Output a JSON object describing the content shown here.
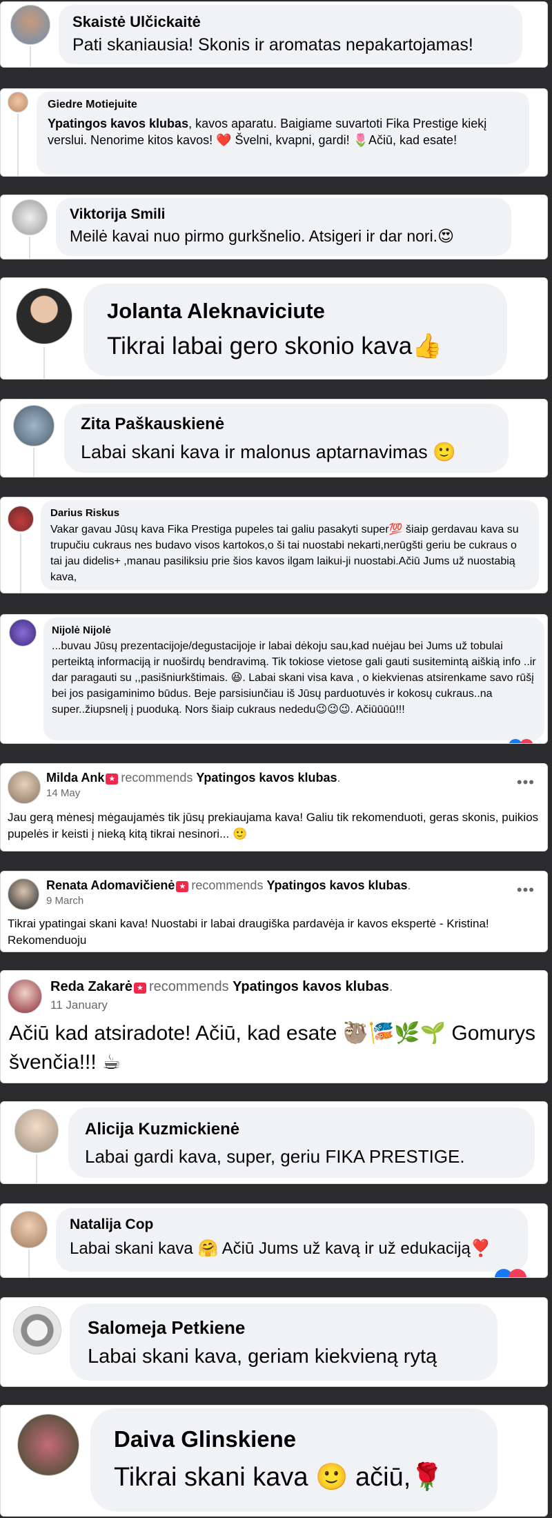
{
  "comments": [
    {
      "name": "Skaistė Ulčickaitė",
      "text": "Pati skaniausia! Skonis ir aromatas nepakartojamas!"
    },
    {
      "name": "Giedre Motiejuite",
      "text_bold": "Ypatingos kavos klubas",
      "text": ", kavos aparatu. Baigiame suvartoti Fika Prestige kiekį verslui. Nenorime kitos kavos! ❤️ Švelni, kvapni, gardi! 🌷Ačiū, kad esate!"
    },
    {
      "name": "Viktorija Smili",
      "text": "Meilė kavai nuo pirmo gurkšnelio. Atsigeri ir dar nori.😍"
    },
    {
      "name": "Jolanta Aleknaviciute",
      "text": "Tikrai labai gero skonio kava👍"
    },
    {
      "name": "Zita Paškauskienė",
      "text": "Labai skani kava ir malonus aptarnavimas 🙂"
    },
    {
      "name": "Darius Riskus",
      "text": "Vakar gavau Jūsų kava Fika Prestiga pupeles tai galiu pasakyti super💯 šiaip gerdavau kava su trupučiu cukraus nes budavo visos kartokos,o ši tai nuostabi nekarti,nerūgšti geriu be cukraus o tai jau didelis+ ,manau pasiliksiu prie šios kavos ilgam laikui-ji nuostabi.Ačiū Jums už nuostabią kava,"
    },
    {
      "name": "Nijolė Nijolė",
      "text": "...buvau Jūsų prezentacijoje/degustacijoje ir labai dėkoju sau,kad nuėjau bei Jums už tobulai perteiktą informaciją ir nuoširdų bendravimą. Tik tokiose vietose gali gauti susitemintą aiškią info ..ir dar paragauti su ,,pasišniurkštimais. 😆. Labai skani visa kava , o kiekvienas atsirenkame savo rūšį bei jos pasigaminimo būdus. Beje parsisiunčiau iš Jūsų parduotuvės ir kokosų cukraus..na super..žiupsnelį į puoduką. Nors šiaip cukraus nededu😉😉😉. Ačiūūūū!!!"
    }
  ],
  "recommendations": [
    {
      "name": "Milda Ank",
      "verb": "recommends",
      "page": "Ypatingos kavos klubas",
      "date": "14 May",
      "text": "Jau gerą mėnesį mėgaujamės tik jūsų prekiaujama kava! Galiu tik rekomenduoti, geras skonis, puikios pupelės ir keisti į nieką kitą tikrai nesinori... 🙂"
    },
    {
      "name": "Renata Adomavičienė",
      "verb": "recommends",
      "page": "Ypatingos kavos klubas",
      "date": "9 March",
      "text": "Tikrai ypatingai skani kava! Nuostabi ir labai draugiška pardavėja ir kavos ekspertė - Kristina! Rekomenduoju"
    },
    {
      "name": "Reda Zakarė",
      "verb": "recommends",
      "page": "Ypatingos kavos klubas",
      "date": "11 January",
      "text": "Ačiū kad atsiradote! Ačiū, kad esate 🦥🎏🌿🌱 Gomurys švenčia!!! ☕"
    }
  ],
  "comments2": [
    {
      "name": "Alicija Kuzmickienė",
      "text": "Labai gardi kava, super, geriu FIKA PRESTIGE."
    },
    {
      "name": "Natalija Cop",
      "text": "Labai skani kava 🤗 Ačiū Jums už kavą ir už edukaciją❣️"
    },
    {
      "name": "Salomeja Petkiene",
      "text": "Labai skani kava, geriam kiekvieną rytą"
    },
    {
      "name": "Daiva Glinskiene",
      "text": "Tikrai skani kava 🙂 ačiū,🌹"
    }
  ],
  "ui": {
    "more": "•••",
    "period": "."
  },
  "colors": {
    "bubble": "#f0f2f5",
    "background": "#2b2b2d",
    "badge": "#f02849"
  }
}
